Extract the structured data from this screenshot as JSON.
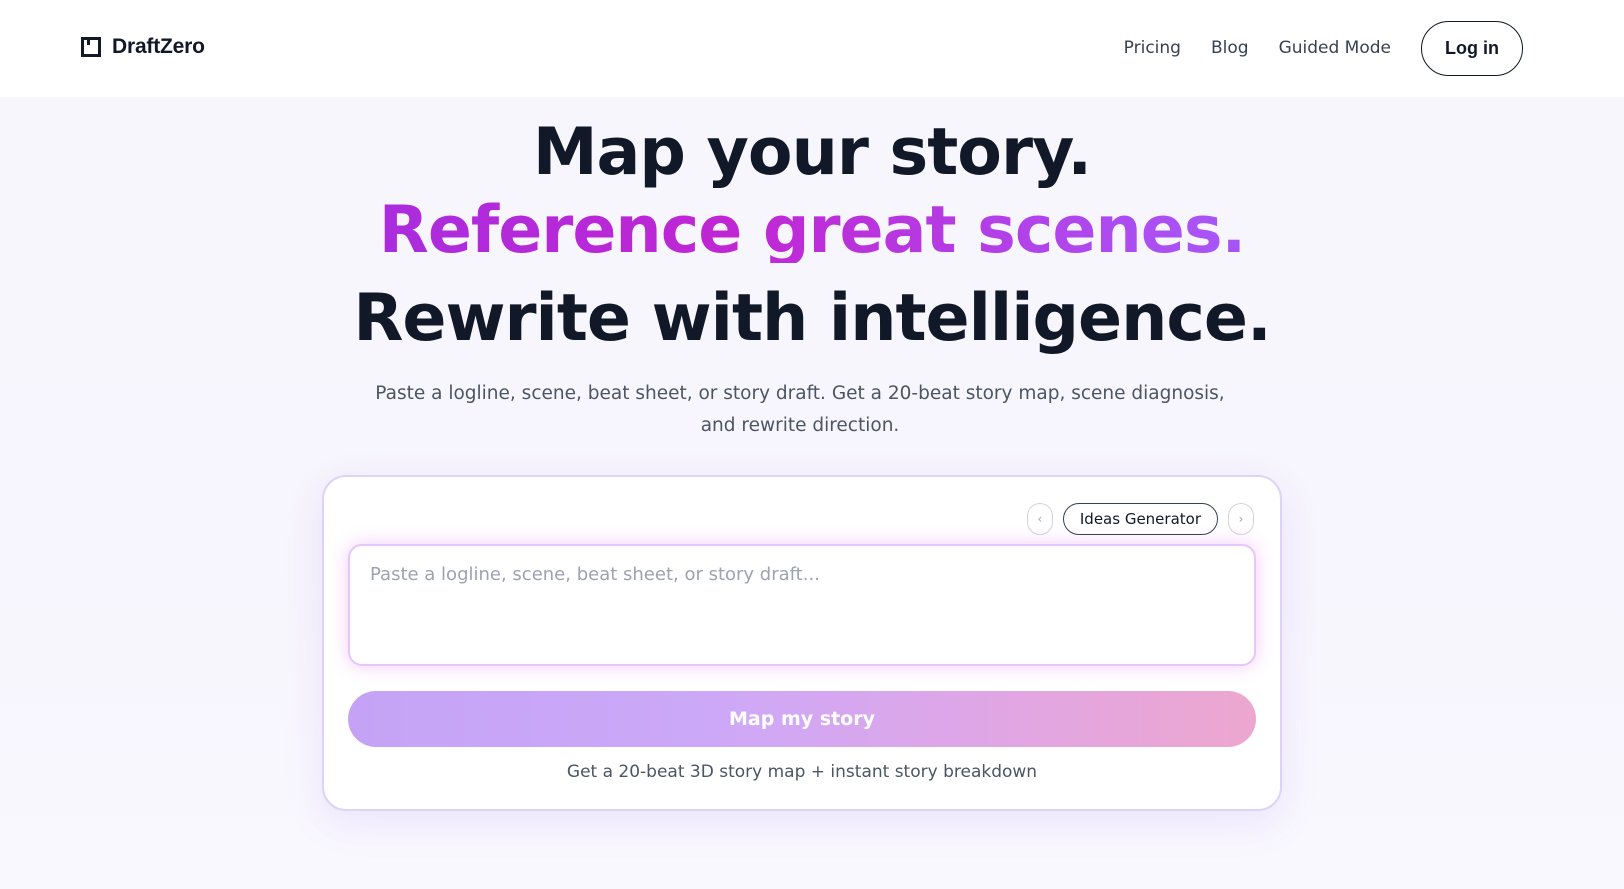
{
  "brand": {
    "name": "DraftZero"
  },
  "nav": {
    "links": [
      "Pricing",
      "Blog",
      "Guided Mode"
    ],
    "login_label": "Log in"
  },
  "hero": {
    "line1": "Map your story.",
    "line2": "Reference great scenes.",
    "line3": "Rewrite with intelligence.",
    "subtitle": "Paste a logline, scene, beat sheet, or story draft. Get a 20-beat story map, scene diagnosis, and rewrite direction."
  },
  "composer": {
    "prev_icon": "‹",
    "next_icon": "›",
    "mode_chip": "Ideas Generator",
    "input_value": "",
    "input_placeholder": "Paste a logline, scene, beat sheet, or story draft...",
    "submit_label": "Map my story",
    "note": "Get a 20-beat 3D story map + instant story breakdown"
  },
  "colors": {
    "accent_purple": "#9333ea",
    "accent_magenta": "#c026d3",
    "cta_start": "#c4a3f6",
    "cta_end": "#eda7cf"
  }
}
